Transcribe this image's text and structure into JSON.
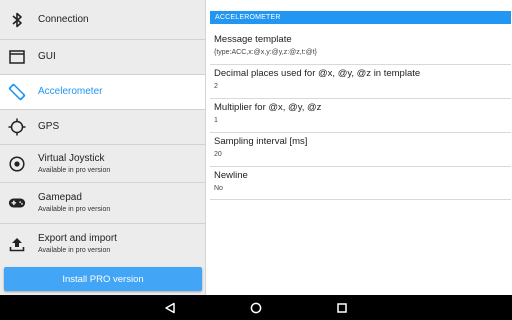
{
  "sidebar": {
    "items": [
      {
        "label": "Connection",
        "sub": "",
        "icon": "bluetooth-icon"
      },
      {
        "label": "GUI",
        "sub": "",
        "icon": "window-icon"
      },
      {
        "label": "Accelerometer",
        "sub": "",
        "icon": "screen-rotation-icon",
        "active": true
      },
      {
        "label": "GPS",
        "sub": "",
        "icon": "gps-crosshair-icon"
      },
      {
        "label": "Virtual Joystick",
        "sub": "Available in pro version",
        "icon": "joystick-icon"
      },
      {
        "label": "Gamepad",
        "sub": "Available in pro version",
        "icon": "gamepad-icon"
      },
      {
        "label": "Export and import",
        "sub": "Available in pro version",
        "icon": "upload-icon"
      }
    ],
    "pro_button": "Install PRO version"
  },
  "main": {
    "section": "ACCELEROMETER",
    "settings": [
      {
        "title": "Message template",
        "value": "{type:ACC,x:@x,y:@y,z:@z,t:@t}"
      },
      {
        "title": "Decimal places used for @x, @y, @z in template",
        "value": "2"
      },
      {
        "title": "Multiplier for @x, @y, @z",
        "value": "1"
      },
      {
        "title": "Sampling interval [ms]",
        "value": "20"
      },
      {
        "title": "Newline",
        "value": "No"
      }
    ]
  },
  "navbar": {
    "back_icon": "back-triangle-icon",
    "home_icon": "home-circle-icon",
    "recents_icon": "recents-square-icon"
  },
  "colors": {
    "accent": "#2196f3",
    "pro_button": "#42a5f5",
    "sidebar_bg": "#ececec"
  }
}
